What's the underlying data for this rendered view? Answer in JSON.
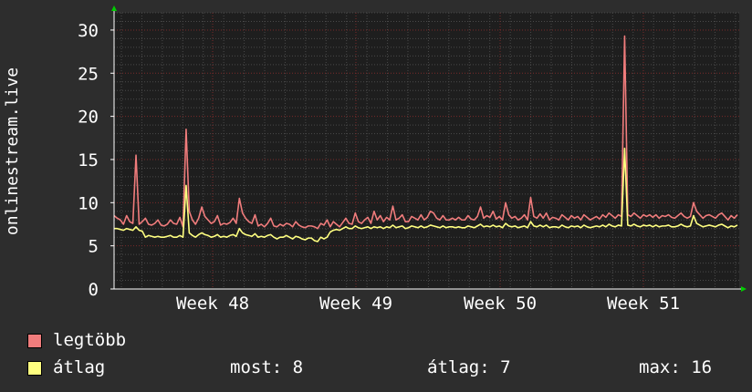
{
  "chart_data": {
    "type": "line",
    "ylabel": "onlinestream.live",
    "ylim": [
      0,
      32
    ],
    "yticks": [
      0,
      5,
      10,
      15,
      20,
      25,
      30
    ],
    "x_tick_labels": [
      "Week 48",
      "Week 49",
      "Week 50",
      "Week 51"
    ],
    "grid": true,
    "colors": {
      "background": "#2d2d2d",
      "plot_background": "#1e1e1e",
      "grid_minor": "#4a4a4a",
      "grid_major": "#7a2a2a",
      "axis": "#ffffff",
      "arrow": "#00cc00"
    },
    "series": [
      {
        "name": "legtöbb",
        "color": "#f07c7c",
        "values": [
          8.5,
          8.2,
          8.0,
          7.5,
          8.5,
          7.8,
          7.6,
          15.5,
          7.5,
          7.8,
          8.2,
          7.5,
          7.4,
          7.6,
          8.0,
          7.4,
          7.3,
          7.5,
          8.0,
          7.6,
          7.5,
          8.3,
          7.2,
          18.5,
          9.0,
          8.0,
          7.5,
          8.2,
          9.5,
          8.4,
          8.0,
          7.6,
          7.8,
          8.5,
          7.4,
          7.6,
          7.5,
          7.7,
          8.2,
          7.6,
          10.5,
          8.8,
          8.2,
          7.8,
          7.6,
          8.6,
          7.3,
          7.5,
          7.2,
          7.6,
          8.2,
          7.3,
          7.2,
          7.5,
          7.3,
          7.6,
          7.5,
          7.2,
          7.8,
          7.4,
          7.2,
          7.1,
          7.3,
          7.3,
          7.2,
          7.0,
          7.6,
          7.4,
          8.0,
          7.2,
          7.8,
          7.5,
          7.2,
          7.7,
          8.2,
          7.6,
          7.5,
          8.8,
          7.8,
          7.6,
          8.0,
          8.3,
          7.6,
          9.0,
          8.0,
          8.5,
          7.8,
          8.3,
          8.0,
          9.6,
          8.0,
          8.2,
          8.6,
          7.8,
          7.8,
          8.4,
          8.2,
          8.0,
          8.6,
          8.0,
          8.3,
          9.0,
          8.8,
          8.2,
          8.0,
          8.5,
          8.0,
          8.0,
          8.2,
          8.0,
          8.3,
          8.0,
          8.0,
          8.5,
          8.1,
          8.0,
          8.4,
          9.5,
          8.2,
          8.5,
          8.3,
          9.0,
          8.1,
          8.4,
          8.0,
          10.0,
          8.6,
          8.2,
          8.4,
          8.0,
          8.2,
          8.6,
          8.0,
          10.6,
          8.4,
          8.2,
          8.7,
          8.2,
          8.8,
          8.0,
          8.3,
          8.2,
          8.0,
          8.6,
          8.3,
          8.0,
          8.5,
          8.2,
          8.4,
          8.0,
          8.6,
          8.3,
          8.0,
          8.2,
          8.4,
          8.1,
          8.6,
          8.3,
          8.8,
          8.5,
          8.2,
          8.6,
          8.4,
          29.3,
          8.6,
          8.4,
          8.8,
          8.5,
          8.2,
          8.6,
          8.4,
          8.6,
          8.3,
          8.6,
          8.2,
          8.5,
          8.4,
          8.6,
          8.3,
          8.2,
          8.5,
          8.8,
          8.4,
          8.2,
          8.4,
          10.0,
          9.0,
          8.6,
          8.2,
          8.5,
          8.6,
          8.4,
          8.2,
          8.6,
          8.8,
          8.4,
          8.0,
          8.5,
          8.2,
          8.6
        ]
      },
      {
        "name": "átlag",
        "color": "#ffff80",
        "values": [
          7.0,
          7.0,
          6.9,
          6.8,
          7.0,
          6.9,
          6.8,
          7.2,
          6.8,
          6.7,
          6.0,
          6.2,
          6.1,
          6.0,
          6.1,
          6.0,
          6.0,
          6.1,
          6.2,
          6.0,
          6.0,
          6.2,
          6.0,
          12.0,
          6.5,
          6.2,
          6.0,
          6.3,
          6.5,
          6.3,
          6.2,
          6.0,
          6.1,
          6.3,
          6.0,
          6.1,
          6.0,
          6.2,
          6.3,
          6.1,
          7.0,
          6.5,
          6.3,
          6.2,
          6.1,
          6.4,
          6.0,
          6.1,
          6.0,
          6.2,
          6.3,
          6.0,
          5.8,
          6.0,
          6.0,
          6.2,
          6.0,
          5.8,
          6.1,
          6.0,
          5.8,
          5.7,
          5.9,
          5.9,
          5.6,
          5.5,
          6.0,
          5.8,
          6.0,
          6.6,
          6.8,
          6.9,
          6.8,
          7.0,
          7.2,
          7.0,
          7.0,
          7.3,
          7.1,
          7.0,
          7.1,
          7.2,
          7.0,
          7.2,
          7.1,
          7.2,
          7.0,
          7.2,
          7.1,
          7.4,
          7.1,
          7.2,
          7.3,
          7.0,
          7.1,
          7.3,
          7.2,
          7.1,
          7.3,
          7.1,
          7.2,
          7.4,
          7.3,
          7.2,
          7.1,
          7.3,
          7.1,
          7.2,
          7.2,
          7.1,
          7.2,
          7.1,
          7.1,
          7.3,
          7.2,
          7.1,
          7.3,
          7.5,
          7.2,
          7.3,
          7.2,
          7.4,
          7.2,
          7.3,
          7.1,
          7.6,
          7.3,
          7.2,
          7.3,
          7.1,
          7.2,
          7.3,
          7.1,
          7.8,
          7.3,
          7.2,
          7.4,
          7.2,
          7.4,
          7.1,
          7.2,
          7.2,
          7.1,
          7.4,
          7.2,
          7.1,
          7.3,
          7.2,
          7.3,
          7.1,
          7.4,
          7.2,
          7.1,
          7.2,
          7.3,
          7.2,
          7.4,
          7.2,
          7.5,
          7.3,
          7.2,
          7.4,
          7.3,
          16.3,
          7.4,
          7.3,
          7.5,
          7.3,
          7.2,
          7.4,
          7.3,
          7.4,
          7.2,
          7.4,
          7.2,
          7.3,
          7.3,
          7.4,
          7.2,
          7.2,
          7.3,
          7.5,
          7.3,
          7.2,
          7.3,
          8.5,
          7.6,
          7.4,
          7.2,
          7.3,
          7.4,
          7.3,
          7.2,
          7.4,
          7.5,
          7.3,
          7.1,
          7.3,
          7.2,
          7.4
        ]
      }
    ]
  },
  "legend": {
    "stats": {
      "most_label": "most:",
      "most_value": "8",
      "avg_label": "átlag:",
      "avg_value": "7",
      "max_label": "max:",
      "max_value": "16"
    }
  }
}
